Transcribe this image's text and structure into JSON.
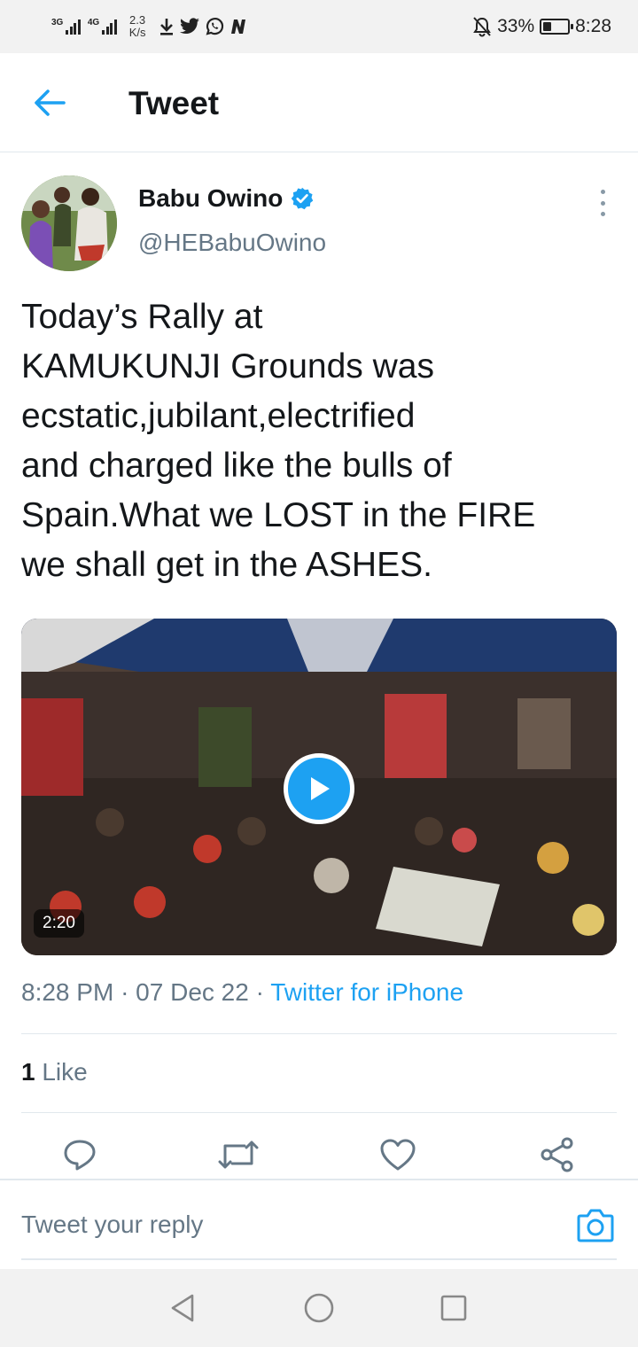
{
  "status_bar": {
    "sim1_label": "3G",
    "sim2_label": "4G",
    "speed_value": "2.3",
    "speed_unit": "K/s",
    "battery_percent": "33%",
    "battery_level": 0.33,
    "time": "8:28",
    "icons": [
      "download-icon",
      "twitter-bird-icon",
      "whatsapp-icon",
      "n-app-icon",
      "mute-bell-icon",
      "battery-icon"
    ]
  },
  "header": {
    "title": "Tweet",
    "back_icon": "arrow-left-icon"
  },
  "tweet": {
    "author_name": "Babu Owino",
    "author_handle": "@HEBabuOwino",
    "verified": true,
    "text": "Today’s Rally at\nKAMUKUNJI Grounds was\necstatic,jubilant,electrified\nand charged like the bulls of\nSpain.What we LOST in the FIRE\nwe shall get in the ASHES.",
    "media": {
      "type": "video",
      "duration": "2:20"
    },
    "time": "8:28 PM",
    "separator": "·",
    "date": "07 Dec 22",
    "source": "Twitter for iPhone",
    "like_count": "1",
    "like_label": "Like"
  },
  "actions": [
    "reply-icon",
    "retweet-icon",
    "like-heart-icon",
    "share-icon"
  ],
  "reply_bar": {
    "placeholder": "Tweet your reply",
    "camera_icon": "camera-icon"
  },
  "system_nav": [
    "back-triangle-icon",
    "home-circle-icon",
    "recents-square-icon"
  ],
  "colors": {
    "accent": "#1da1f2",
    "text_primary": "#14171a",
    "text_secondary": "#657786",
    "divider": "#e1e8ed",
    "system_bar_bg": "#f2f2f2"
  }
}
